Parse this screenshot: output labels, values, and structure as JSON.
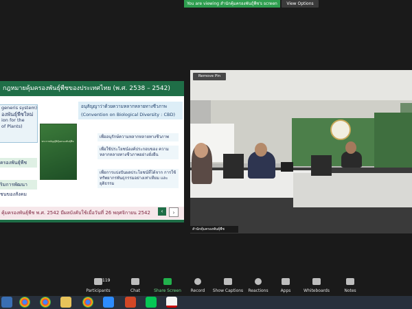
{
  "banner": {
    "text": "You are viewing สำนักคุ้มครองพันธุ์พืช's screen",
    "view_options": "View Options"
  },
  "slide": {
    "title": "กฎหมายคุ้มครองพันธุ์พืชของประเทศไทย (พ.ศ. 2538 – 2542)",
    "left_box_lines": [
      "generis system)",
      "องพันธุ์พืชใหม่",
      "ion for the",
      "of Plants)"
    ],
    "left_items": [
      "ครองพันธุ์พืช",
      "ริมการพัฒนา",
      "ชนของสังคม"
    ],
    "book_title": "พระราชบัญญัติคุ้มครองพันธุ์พืช",
    "cbd_heading_th": "อนุสัญญาว่าด้วยความหลากหลายทางชีวภาพ",
    "cbd_heading_en": "(Convention on Biological Diversity : CBD)",
    "objectives": [
      "เพื่ออนุรักษ์ความหลากหลายทางชีวภาพ",
      "เพื่อใช้ประโยชน์องค์ประกอบของ ความหลากหลายทางชีวภาพอย่างยั่งยืน",
      "เพื่อการแบ่งปันผลประโยชน์ที่ได้จาก การใช้ทรัพยากรพันธุกรรมอย่างเท่าเทียม และยุติธรรม"
    ],
    "footer": "คุ้มครองพันธุ์พืช พ.ศ. 2542 มีผลบังคับใช้เมื่อวันที่ 26 พฤศจิกายน 2542",
    "prev_label": "‹",
    "next_label": "›"
  },
  "video": {
    "remove_pin": "Remove Pin",
    "participant_name": "สำนักคุ้มครองพันธุ์พืช"
  },
  "toolbar": {
    "participants_count": "119",
    "items": [
      {
        "label": "Participants"
      },
      {
        "label": "Chat"
      },
      {
        "label": "Share Screen"
      },
      {
        "label": "Record"
      },
      {
        "label": "Show Captions"
      },
      {
        "label": "Reactions"
      },
      {
        "label": "Apps"
      },
      {
        "label": "Whiteboards"
      },
      {
        "label": "Notes"
      }
    ]
  },
  "colors": {
    "slide_green": "#1f6e47",
    "share_green": "#22b14c",
    "banner_green": "#2e9e4f"
  },
  "taskbar": {
    "apps": [
      "chrome-icon",
      "chrome-icon",
      "folder-icon",
      "chrome-icon",
      "zoom-icon",
      "powerpoint-icon",
      "line-icon",
      "acrobat-icon"
    ]
  }
}
